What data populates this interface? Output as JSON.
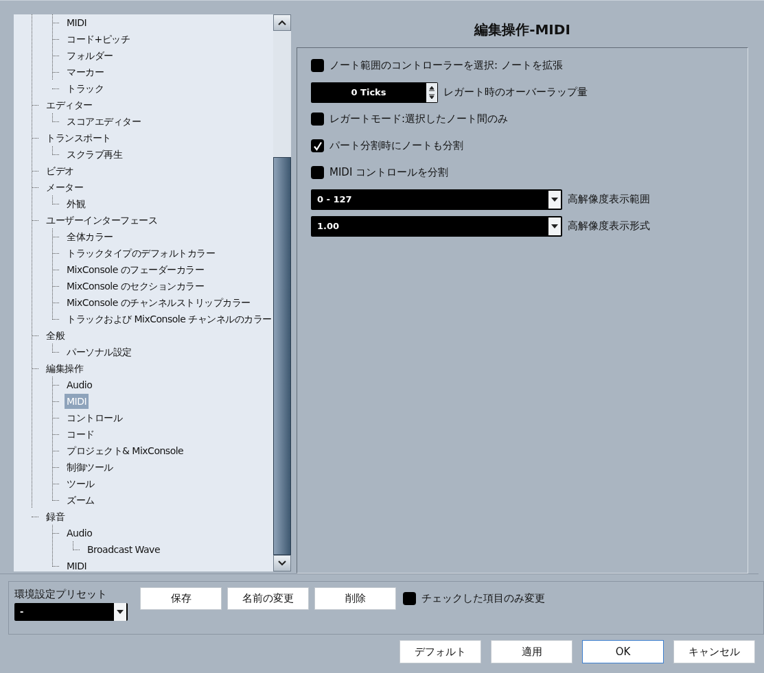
{
  "title": "編集操作-MIDI",
  "tree": {
    "partial_group": [
      {
        "label": "MIDI",
        "selected": false
      },
      {
        "label": "コード+ピッチ",
        "selected": false
      },
      {
        "label": "フォルダー",
        "selected": false
      },
      {
        "label": "マーカー",
        "selected": false
      },
      {
        "label": "トラック",
        "selected": false
      }
    ],
    "items": [
      {
        "label": "エディター",
        "selected": false,
        "children": [
          {
            "label": "スコアエディター",
            "selected": false
          }
        ]
      },
      {
        "label": "トランスポート",
        "selected": false,
        "children": [
          {
            "label": "スクラブ再生",
            "selected": false
          }
        ]
      },
      {
        "label": "ビデオ",
        "selected": false
      },
      {
        "label": "メーター",
        "selected": false,
        "children": [
          {
            "label": "外観",
            "selected": false
          }
        ]
      },
      {
        "label": "ユーザーインターフェース",
        "selected": false,
        "children": [
          {
            "label": "全体カラー",
            "selected": false
          },
          {
            "label": "トラックタイプのデフォルトカラー",
            "selected": false
          },
          {
            "label": "MixConsole のフェーダーカラー",
            "selected": false
          },
          {
            "label": "MixConsole のセクションカラー",
            "selected": false
          },
          {
            "label": "MixConsole のチャンネルストリップカラー",
            "selected": false
          },
          {
            "label": "トラックおよび MixConsole チャンネルのカラー",
            "selected": false
          }
        ]
      },
      {
        "label": "全般",
        "selected": false,
        "children": [
          {
            "label": "パーソナル設定",
            "selected": false
          }
        ]
      },
      {
        "label": "編集操作",
        "selected": false,
        "children": [
          {
            "label": "Audio",
            "selected": false
          },
          {
            "label": "MIDI",
            "selected": true
          },
          {
            "label": "コントロール",
            "selected": false
          },
          {
            "label": "コード",
            "selected": false
          },
          {
            "label": "プロジェクト& MixConsole",
            "selected": false
          },
          {
            "label": "制御ツール",
            "selected": false
          },
          {
            "label": "ツール",
            "selected": false
          },
          {
            "label": "ズーム",
            "selected": false
          }
        ]
      },
      {
        "label": "録音",
        "selected": false,
        "children": [
          {
            "label": "Audio",
            "selected": false,
            "children": [
              {
                "label": "Broadcast Wave",
                "selected": false
              }
            ]
          },
          {
            "label": "MIDI",
            "selected": false
          }
        ]
      }
    ]
  },
  "options": [
    {
      "kind": "checkbox",
      "label": "ノート範囲のコントローラーを選択: ノートを拡張",
      "checked": false
    },
    {
      "kind": "spinbox",
      "field": {
        "value": "0 Ticks"
      },
      "label": "レガート時のオーバーラップ量"
    },
    {
      "kind": "checkbox",
      "label": "レガートモード:選択したノート間のみ",
      "checked": false
    },
    {
      "kind": "checkbox",
      "label": "パート分割時にノートも分割",
      "checked": true
    },
    {
      "kind": "checkbox",
      "label": "MIDI コントロールを分割",
      "checked": false
    },
    {
      "kind": "dropdown",
      "field": {
        "value": "0 - 127"
      },
      "label": "高解像度表示範囲"
    },
    {
      "kind": "dropdown",
      "field": {
        "value": "1.00"
      },
      "label": "高解像度表示形式"
    }
  ],
  "preset": {
    "label": "環境設定プリセット",
    "value": "-",
    "buttons": [
      "保存",
      "名前の変更",
      "削除"
    ],
    "option": {
      "label": "チェックした項目のみ変更",
      "checked": false
    }
  },
  "buttons": [
    {
      "label": "デフォルト",
      "default": false
    },
    {
      "label": "適用",
      "default": false
    },
    {
      "label": "OK",
      "default": true
    },
    {
      "label": "キャンセル",
      "default": false
    }
  ]
}
